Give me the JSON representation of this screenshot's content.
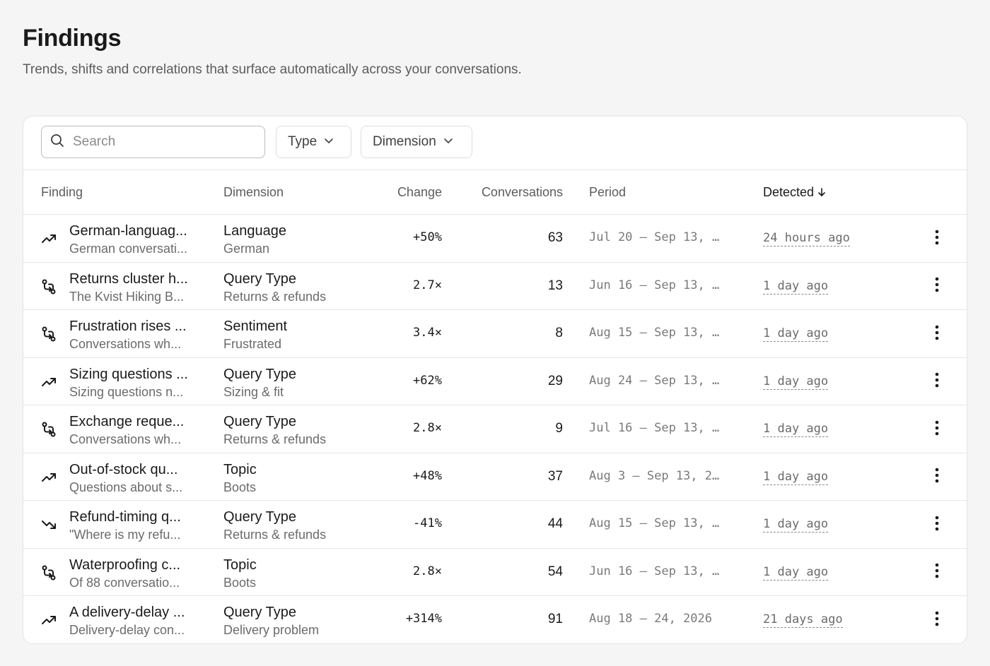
{
  "header": {
    "title": "Findings",
    "subtitle": "Trends, shifts and correlations that surface automatically across your conversations."
  },
  "toolbar": {
    "search_placeholder": "Search",
    "search_value": "",
    "type_label": "Type",
    "dimension_label": "Dimension"
  },
  "table": {
    "columns": {
      "finding": "Finding",
      "dimension": "Dimension",
      "change": "Change",
      "conversations": "Conversations",
      "period": "Period",
      "detected": "Detected"
    },
    "sort": {
      "column": "detected",
      "direction": "descending",
      "icon": "arrow-down-icon"
    },
    "rows": [
      {
        "icon": "trend-up-icon",
        "title": "German-languag...",
        "desc": "German conversati...",
        "dimension": "Language",
        "dimension_value": "German",
        "change": "+50%",
        "conversations": "63",
        "period": "Jul 20 – Sep 13, …",
        "detected": "24 hours ago"
      },
      {
        "icon": "correlation-icon",
        "title": "Returns cluster h...",
        "desc": "The Kvist Hiking B...",
        "dimension": "Query Type",
        "dimension_value": "Returns & refunds",
        "change": "2.7×",
        "conversations": "13",
        "period": "Jun 16 – Sep 13, …",
        "detected": "1 day ago"
      },
      {
        "icon": "correlation-icon",
        "title": "Frustration rises ...",
        "desc": "Conversations wh...",
        "dimension": "Sentiment",
        "dimension_value": "Frustrated",
        "change": "3.4×",
        "conversations": "8",
        "period": "Aug 15 – Sep 13, …",
        "detected": "1 day ago"
      },
      {
        "icon": "trend-up-icon",
        "title": "Sizing questions ...",
        "desc": "Sizing questions n...",
        "dimension": "Query Type",
        "dimension_value": "Sizing & fit",
        "change": "+62%",
        "conversations": "29",
        "period": "Aug 24 – Sep 13, …",
        "detected": "1 day ago"
      },
      {
        "icon": "correlation-icon",
        "title": "Exchange reque...",
        "desc": "Conversations wh...",
        "dimension": "Query Type",
        "dimension_value": "Returns & refunds",
        "change": "2.8×",
        "conversations": "9",
        "period": "Jul 16 – Sep 13, …",
        "detected": "1 day ago"
      },
      {
        "icon": "trend-up-icon",
        "title": "Out-of-stock qu...",
        "desc": "Questions about s...",
        "dimension": "Topic",
        "dimension_value": "Boots",
        "change": "+48%",
        "conversations": "37",
        "period": "Aug 3 – Sep 13, 2…",
        "detected": "1 day ago"
      },
      {
        "icon": "trend-down-icon",
        "title": "Refund-timing q...",
        "desc": "\"Where is my refu...",
        "dimension": "Query Type",
        "dimension_value": "Returns & refunds",
        "change": "-41%",
        "conversations": "44",
        "period": "Aug 15 – Sep 13, …",
        "detected": "1 day ago"
      },
      {
        "icon": "correlation-icon",
        "title": "Waterproofing c...",
        "desc": "Of 88 conversatio...",
        "dimension": "Topic",
        "dimension_value": "Boots",
        "change": "2.8×",
        "conversations": "54",
        "period": "Jun 16 – Sep 13, …",
        "detected": "1 day ago"
      },
      {
        "icon": "trend-up-icon",
        "title": "A delivery-delay ...",
        "desc": "Delivery-delay con...",
        "dimension": "Query Type",
        "dimension_value": "Delivery problem",
        "change": "+314%",
        "conversations": "91",
        "period": "Aug 18 – 24, 2026",
        "detected": "21 days ago"
      }
    ]
  }
}
